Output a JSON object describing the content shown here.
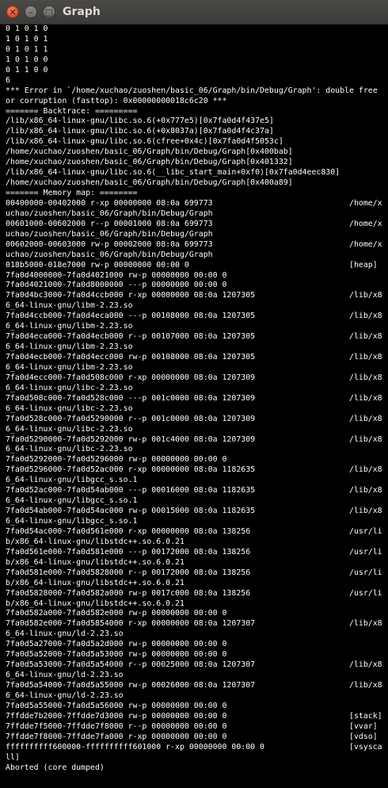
{
  "window": {
    "title": "Graph"
  },
  "terminal": {
    "lines": [
      "0 1 0 1 0",
      "1 0 1 0 1",
      "0 1 0 1 1",
      "1 0 1 0 0",
      "0 1 1 0 0",
      "6",
      "*** Error in `/home/xuchao/zuoshen/basic_06/Graph/bin/Debug/Graph': double free",
      "or corruption (fasttop): 0x00000000018c6c20 ***",
      "======= Backtrace: =========",
      "/lib/x86_64-linux-gnu/libc.so.6(+0x777e5)[0x7fa0d4f437e5]",
      "/lib/x86_64-linux-gnu/libc.so.6(+0x8037a)[0x7fa0d4f4c37a]",
      "/lib/x86_64-linux-gnu/libc.so.6(cfree+0x4c)[0x7fa0d4f5053c]",
      "/home/xuchao/zuoshen/basic_06/Graph/bin/Debug/Graph[0x400bab]",
      "/home/xuchao/zuoshen/basic_06/Graph/bin/Debug/Graph[0x401332]",
      "/lib/x86_64-linux-gnu/libc.so.6(__libc_start_main+0xf0)[0x7fa0d4eec830]",
      "/home/xuchao/zuoshen/basic_06/Graph/bin/Debug/Graph[0x400a89]",
      "======= Memory map: ========",
      "00400000-00402000 r-xp 00000000 08:0a 699773                             /home/x",
      "uchao/zuoshen/basic_06/Graph/bin/Debug/Graph",
      "00601000-00602000 r--p 00001000 08:0a 699773                             /home/x",
      "uchao/zuoshen/basic_06/Graph/bin/Debug/Graph",
      "00602000-00603000 rw-p 00002000 08:0a 699773                             /home/x",
      "uchao/zuoshen/basic_06/Graph/bin/Debug/Graph",
      "018b5000-018e7000 rw-p 00000000 00:00 0                                  [heap]",
      "7fa0d4000000-7fa0d4021000 rw-p 00000000 00:00 0",
      "7fa0d4021000-7fa0d8000000 ---p 00000000 00:00 0",
      "7fa0d4bc3000-7fa0d4ccb000 r-xp 00000000 08:0a 1207305                    /lib/x8",
      "6_64-linux-gnu/libm-2.23.so",
      "7fa0d4ccb000-7fa0d4eca000 ---p 00108000 08:0a 1207305                    /lib/x8",
      "6_64-linux-gnu/libm-2.23.so",
      "7fa0d4eca000-7fa0d4ecb000 r--p 00107000 08:0a 1207305                    /lib/x8",
      "6_64-linux-gnu/libm-2.23.so",
      "7fa0d4ecb000-7fa0d4ecc000 rw-p 00108000 08:0a 1207305                    /lib/x8",
      "6_64-linux-gnu/libm-2.23.so",
      "7fa0d4ecc000-7fa0d508c000 r-xp 00000000 08:0a 1207309                    /lib/x8",
      "6_64-linux-gnu/libc-2.23.so",
      "7fa0d508c000-7fa0d528c000 ---p 001c0000 08:0a 1207309                    /lib/x8",
      "6_64-linux-gnu/libc-2.23.so",
      "7fa0d528c000-7fa0d5290000 r--p 001c0000 08:0a 1207309                    /lib/x8",
      "6_64-linux-gnu/libc-2.23.so",
      "7fa0d5290000-7fa0d5292000 rw-p 001c4000 08:0a 1207309                    /lib/x8",
      "6_64-linux-gnu/libc-2.23.so",
      "7fa0d5292000-7fa0d5296000 rw-p 00000000 00:00 0",
      "7fa0d5296000-7fa0d52ac000 r-xp 00000000 08:0a 1182635                    /lib/x8",
      "6_64-linux-gnu/libgcc_s.so.1",
      "7fa0d52ac000-7fa0d54ab000 ---p 00016000 08:0a 1182635                    /lib/x8",
      "6_64-linux-gnu/libgcc_s.so.1",
      "7fa0d54ab000-7fa0d54ac000 rw-p 00015000 08:0a 1182635                    /lib/x8",
      "6_64-linux-gnu/libgcc_s.so.1",
      "7fa0d54ac000-7fa0d561e000 r-xp 00000000 08:0a 138256                     /usr/li",
      "b/x86_64-linux-gnu/libstdc++.so.6.0.21",
      "7fa0d561e000-7fa0d581e000 ---p 00172000 08:0a 138256                     /usr/li",
      "b/x86_64-linux-gnu/libstdc++.so.6.0.21",
      "7fa0d581e000-7fa0d5828000 r--p 00172000 08:0a 138256                     /usr/li",
      "b/x86_64-linux-gnu/libstdc++.so.6.0.21",
      "7fa0d5828000-7fa0d582a000 rw-p 0017c000 08:0a 138256                     /usr/li",
      "b/x86_64-linux-gnu/libstdc++.so.6.0.21",
      "7fa0d582a000-7fa0d582e000 rw-p 00000000 00:00 0",
      "7fa0d582e000-7fa0d5854000 r-xp 00000000 08:0a 1207307                    /lib/x8",
      "6_64-linux-gnu/ld-2.23.so",
      "7fa0d5a27000-7fa0d5a2d000 rw-p 00000000 00:00 0",
      "7fa0d5a52000-7fa0d5a53000 rw-p 00000000 00:00 0",
      "7fa0d5a53000-7fa0d5a54000 r--p 00025000 08:0a 1207307                    /lib/x8",
      "6_64-linux-gnu/ld-2.23.so",
      "7fa0d5a54000-7fa0d5a55000 rw-p 00026000 08:0a 1207307                    /lib/x8",
      "6_64-linux-gnu/ld-2.23.so",
      "7fa0d5a55000-7fa0d5a56000 rw-p 00000000 00:00 0",
      "7ffdde7b2000-7ffdde7d3000 rw-p 00000000 00:00 0                          [stack]",
      "7ffdde7f5000-7ffdde7f8000 r--p 00000000 00:00 0                          [vvar]",
      "7ffdde7f8000-7ffdde7fa000 r-xp 00000000 00:00 0                          [vdso]",
      "ffffffffff600000-ffffffffff601000 r-xp 00000000 00:00 0                  [vsysca",
      "ll]",
      "Aborted (core dumped)"
    ]
  }
}
